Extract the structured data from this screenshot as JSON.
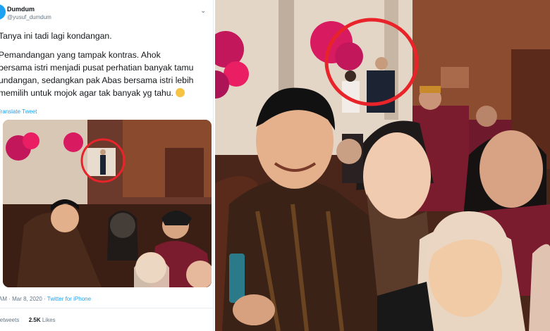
{
  "tweet": {
    "user_name": "Dumdum",
    "user_handle": "@yusuf_dumdum",
    "text_lines": [
      "Tanya ini tadi lagi kondangan.",
      "Pemandangan yang tampak kontras. Ahok",
      "bersama istri menjadi pusat perhatian banyak tamu",
      "undangan, sedangkan pak Abas bersama istri lebih",
      "memilih untuk mojok agar tak banyak yg tahu."
    ],
    "translate_label": "Translate Tweet",
    "timestamp": "AM · Mar 8, 2020",
    "source": "Twitter for iPhone",
    "retweets_label": "Retweets",
    "likes_count": "2.5K",
    "likes_label": "Likes"
  },
  "colors": {
    "link": "#1da1f2",
    "highlight_circle": "#e8232a",
    "maroon": "#7a1b2e"
  },
  "icons": [
    "twitter-avatar-icon",
    "chevron-down-icon",
    "smile-emoji-icon"
  ]
}
